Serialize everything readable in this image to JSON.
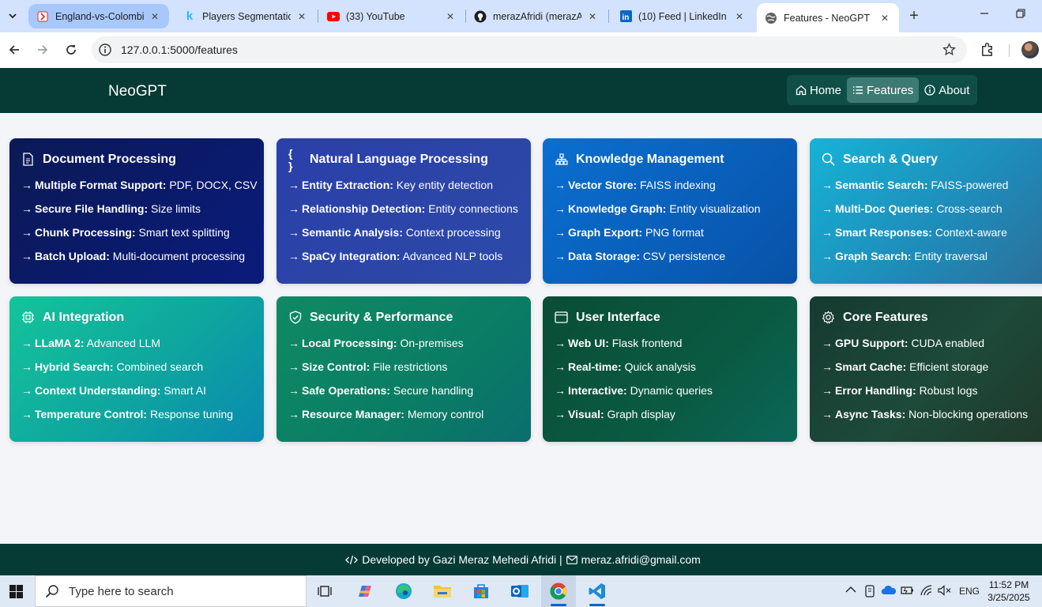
{
  "browser": {
    "tabs": [
      {
        "title": "England-vs-Colombia",
        "icon": "sports-favicon"
      },
      {
        "title": "Players Segmentation",
        "icon": "kaggle-icon"
      },
      {
        "title": "(33) YouTube",
        "icon": "youtube-icon"
      },
      {
        "title": "merazAfridi (merazAf",
        "icon": "github-icon"
      },
      {
        "title": "(10) Feed | LinkedIn",
        "icon": "linkedin-icon"
      },
      {
        "title": "Features - NeoGPT",
        "icon": "globe-icon"
      }
    ],
    "url": "127.0.0.1:5000/features"
  },
  "app": {
    "brand": "NeoGPT",
    "nav": [
      {
        "label": "Home",
        "icon": "home-icon"
      },
      {
        "label": "Features",
        "icon": "list-icon"
      },
      {
        "label": "About",
        "icon": "info-icon"
      }
    ]
  },
  "cards": [
    {
      "title": "Document Processing",
      "icon": "document-icon",
      "features": [
        {
          "name": "Multiple Format Support:",
          "desc": "PDF, DOCX, CSV"
        },
        {
          "name": "Secure File Handling:",
          "desc": "Size limits"
        },
        {
          "name": "Chunk Processing:",
          "desc": "Smart text splitting"
        },
        {
          "name": "Batch Upload:",
          "desc": "Multi-document processing"
        }
      ]
    },
    {
      "title": "Natural Language Processing",
      "icon": "braces-icon",
      "features": [
        {
          "name": "Entity Extraction:",
          "desc": "Key entity detection"
        },
        {
          "name": "Relationship Detection:",
          "desc": "Entity connections"
        },
        {
          "name": "Semantic Analysis:",
          "desc": "Context processing"
        },
        {
          "name": "SpaCy Integration:",
          "desc": "Advanced NLP tools"
        }
      ]
    },
    {
      "title": "Knowledge Management",
      "icon": "diagram-icon",
      "features": [
        {
          "name": "Vector Store:",
          "desc": "FAISS indexing"
        },
        {
          "name": "Knowledge Graph:",
          "desc": "Entity visualization"
        },
        {
          "name": "Graph Export:",
          "desc": "PNG format"
        },
        {
          "name": "Data Storage:",
          "desc": "CSV persistence"
        }
      ]
    },
    {
      "title": "Search & Query",
      "icon": "search-icon",
      "features": [
        {
          "name": "Semantic Search:",
          "desc": "FAISS-powered"
        },
        {
          "name": "Multi-Doc Queries:",
          "desc": "Cross-search"
        },
        {
          "name": "Smart Responses:",
          "desc": "Context-aware"
        },
        {
          "name": "Graph Search:",
          "desc": "Entity traversal"
        }
      ]
    },
    {
      "title": "AI Integration",
      "icon": "cpu-icon",
      "features": [
        {
          "name": "LLaMA 2:",
          "desc": "Advanced LLM"
        },
        {
          "name": "Hybrid Search:",
          "desc": "Combined search"
        },
        {
          "name": "Context Understanding:",
          "desc": "Smart AI"
        },
        {
          "name": "Temperature Control:",
          "desc": "Response tuning"
        }
      ]
    },
    {
      "title": "Security & Performance",
      "icon": "shield-check-icon",
      "features": [
        {
          "name": "Local Processing:",
          "desc": "On-premises"
        },
        {
          "name": "Size Control:",
          "desc": "File restrictions"
        },
        {
          "name": "Safe Operations:",
          "desc": "Secure handling"
        },
        {
          "name": "Resource Manager:",
          "desc": "Memory control"
        }
      ]
    },
    {
      "title": "User Interface",
      "icon": "window-icon",
      "features": [
        {
          "name": "Web UI:",
          "desc": "Flask frontend"
        },
        {
          "name": "Real-time:",
          "desc": "Quick analysis"
        },
        {
          "name": "Interactive:",
          "desc": "Dynamic queries"
        },
        {
          "name": "Visual:",
          "desc": "Graph display"
        }
      ]
    },
    {
      "title": "Core Features",
      "icon": "gear-icon",
      "features": [
        {
          "name": "GPU Support:",
          "desc": "CUDA enabled"
        },
        {
          "name": "Smart Cache:",
          "desc": "Efficient storage"
        },
        {
          "name": "Error Handling:",
          "desc": "Robust logs"
        },
        {
          "name": "Async Tasks:",
          "desc": "Non-blocking operations"
        }
      ]
    }
  ],
  "footer": {
    "developer": "Developed by Gazi Meraz Mehedi Afridi |",
    "email": "meraz.afridi@gmail.com"
  },
  "taskbar": {
    "search_placeholder": "Type here to search",
    "language": "ENG",
    "time": "11:52 PM",
    "date": "3/25/2025"
  }
}
